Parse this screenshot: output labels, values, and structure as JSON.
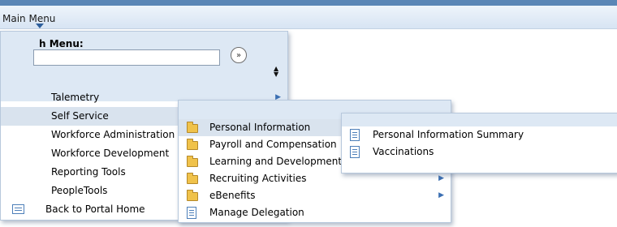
{
  "menubar": {
    "label": "Main Menu"
  },
  "search": {
    "title": "h Menu:",
    "value": "",
    "go_label": "»"
  },
  "main_menu": {
    "items": [
      {
        "label": "Talemetry",
        "submenu": true,
        "selected": false
      },
      {
        "label": "Self Service",
        "submenu": true,
        "selected": true
      },
      {
        "label": "Workforce Administration",
        "submenu": true,
        "selected": false
      },
      {
        "label": "Workforce Development",
        "submenu": true,
        "selected": false
      },
      {
        "label": "Reporting Tools",
        "submenu": true,
        "selected": false
      },
      {
        "label": "PeopleTools",
        "submenu": true,
        "selected": false
      }
    ],
    "home_label": "Back to Portal Home"
  },
  "self_service": {
    "items": [
      {
        "label": "Personal Information",
        "icon": "folder-icon",
        "submenu": true,
        "selected": true
      },
      {
        "label": "Payroll and Compensation",
        "icon": "folder-icon",
        "submenu": true,
        "selected": false
      },
      {
        "label": "Learning and Development",
        "icon": "folder-icon",
        "submenu": true,
        "selected": false
      },
      {
        "label": "Recruiting Activities",
        "icon": "folder-icon",
        "submenu": true,
        "selected": false
      },
      {
        "label": "eBenefits",
        "icon": "folder-icon",
        "submenu": true,
        "selected": false
      },
      {
        "label": "Manage Delegation",
        "icon": "document-icon",
        "submenu": false,
        "selected": false
      }
    ]
  },
  "personal_information": {
    "items": [
      {
        "label": "Personal Information Summary",
        "icon": "document-icon"
      },
      {
        "label": "Vaccinations",
        "icon": "document-icon"
      }
    ]
  },
  "colors": {
    "header_blue": "#5a86b6",
    "panel_header": "#dde8f4",
    "selected_row": "#d9e3ee",
    "arrow_blue": "#3b6fb2"
  }
}
